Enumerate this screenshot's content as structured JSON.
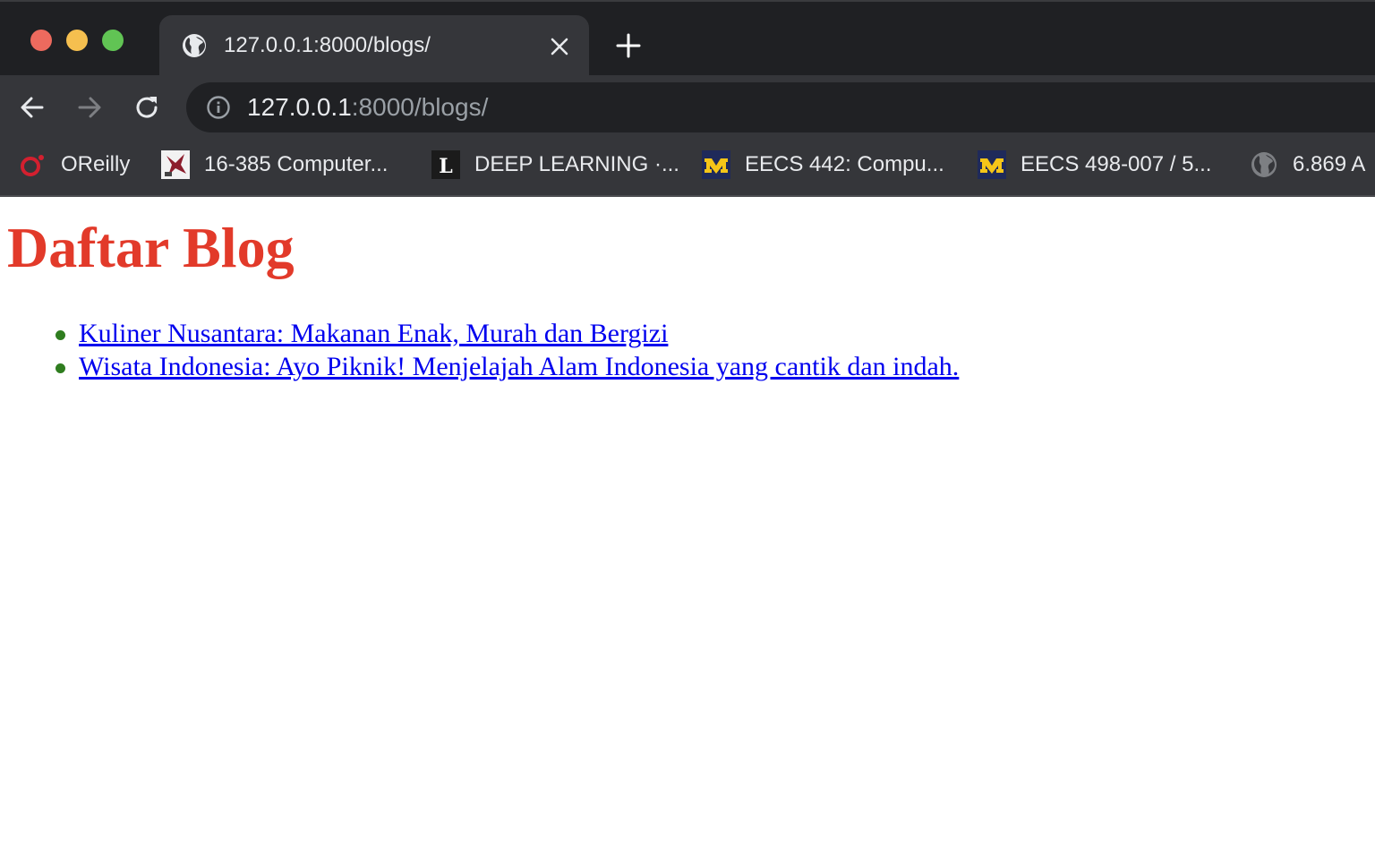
{
  "browser": {
    "tab": {
      "title": "127.0.0.1:8000/blogs/",
      "favicon": "globe-icon"
    },
    "address_bar": {
      "host": "127.0.0.1",
      "rest": ":8000/blogs/"
    },
    "bookmarks": [
      {
        "label": "OReilly",
        "icon": "oreilly-icon"
      },
      {
        "label": "16-385 Computer...",
        "icon": "cmu-icon"
      },
      {
        "label": "DEEP LEARNING ·...",
        "icon": "letter-l-icon"
      },
      {
        "label": "EECS 442: Compu...",
        "icon": "michigan-icon"
      },
      {
        "label": "EECS 498-007 / 5...",
        "icon": "michigan-icon"
      },
      {
        "label": "6.869 A",
        "icon": "globe-icon"
      }
    ]
  },
  "page": {
    "title": "Daftar Blog",
    "title_color": "#e23a2a",
    "bullet_color": "#2f7d1f",
    "blogs": [
      {
        "title": "Kuliner Nusantara: Makanan Enak, Murah dan Bergizi"
      },
      {
        "title": "Wisata Indonesia: Ayo Piknik! Menjelajah Alam Indonesia yang cantik dan indah."
      }
    ]
  }
}
